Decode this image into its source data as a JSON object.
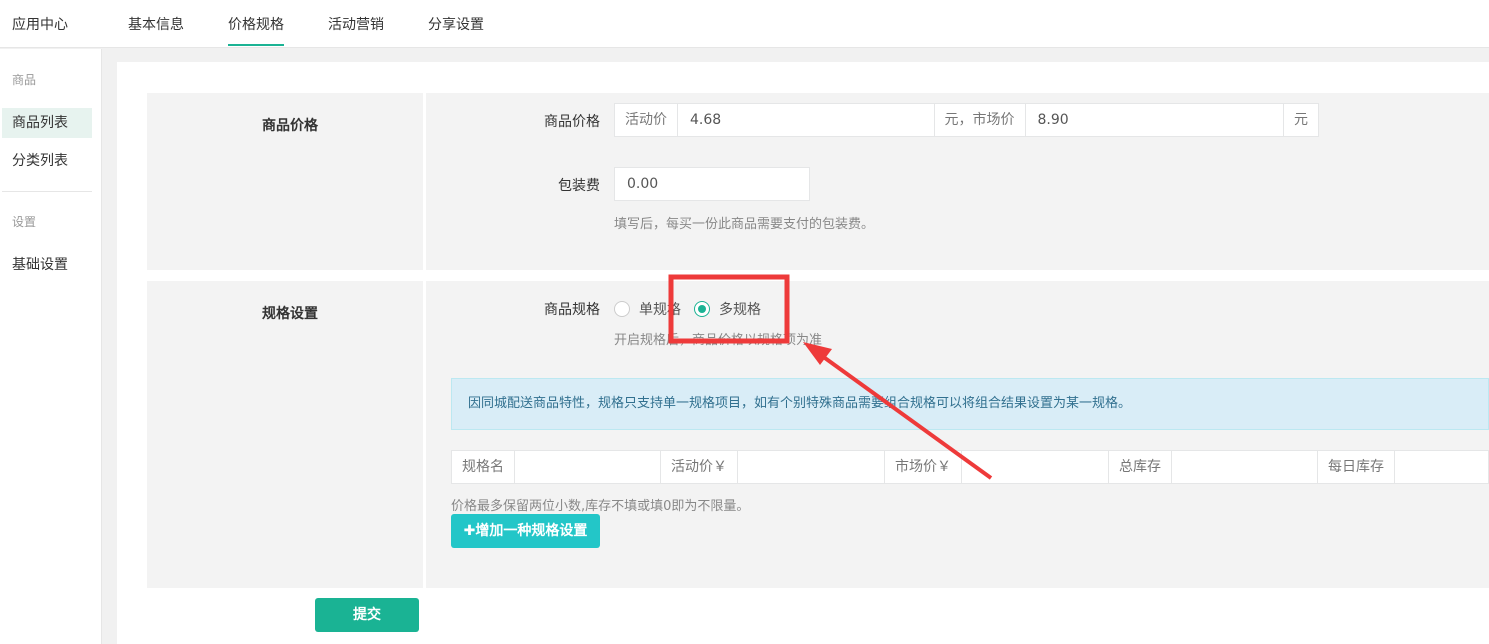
{
  "topbar": {
    "app_title": "应用中心",
    "tabs": [
      {
        "label": "基本信息"
      },
      {
        "label": "价格规格"
      },
      {
        "label": "活动营销"
      },
      {
        "label": "分享设置"
      }
    ],
    "active_tab": "价格规格"
  },
  "sidebar": {
    "section1": "商品",
    "items1": [
      {
        "label": "商品列表"
      },
      {
        "label": "分类列表"
      }
    ],
    "section2": "设置",
    "items2": [
      {
        "label": "基础设置"
      }
    ],
    "active_item": "商品列表"
  },
  "price_section": {
    "title": "商品价格",
    "price_label": "商品价格",
    "activity_price_addon": "活动价",
    "activity_price_value": "4.68",
    "market_price_addon": "元，市场价",
    "market_price_value": "8.90",
    "yuan_addon": "元",
    "packing_label": "包装费",
    "packing_value": "0.00",
    "packing_help": "填写后，每买一份此商品需要支付的包装费。"
  },
  "spec_section": {
    "title": "规格设置",
    "spec_label": "商品规格",
    "radio_single": "单规格",
    "radio_multi": "多规格",
    "selected": "多规格",
    "spec_help": "开启规格后，商品价格以规格项为准",
    "alert": "因同城配送商品特性，规格只支持单一规格项目，如有个别特殊商品需要组合规格可以将组合结果设置为某一规格。",
    "row_labels": {
      "name": "规格名",
      "activity_price": "活动价￥",
      "market_price": "市场价￥",
      "total_stock": "总库存",
      "daily_stock": "每日库存"
    },
    "row_note": "价格最多保留两位小数,库存不填或填0即为不限量。",
    "add_button": "✚增加一种规格设置"
  },
  "submit_button": "提交",
  "annotation": {
    "highlight_color": "#ee3a3a"
  }
}
